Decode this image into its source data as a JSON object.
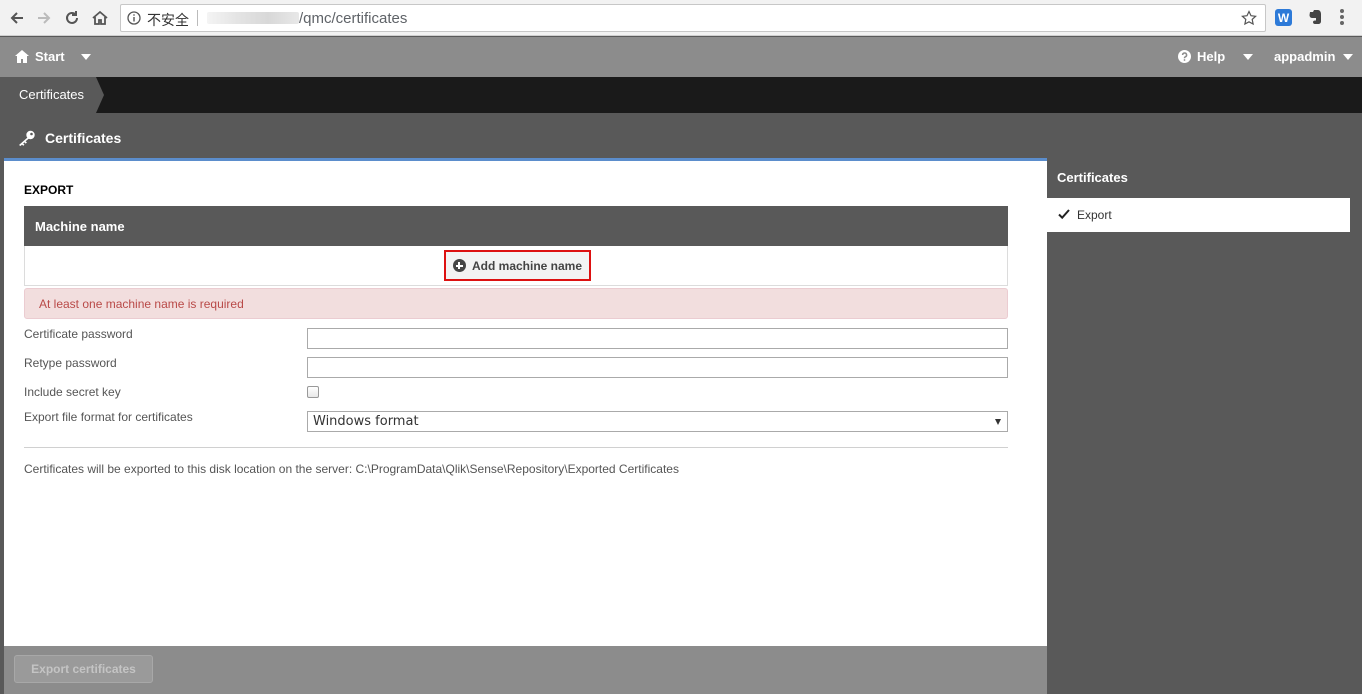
{
  "browser": {
    "insecure_label": "不安全",
    "url_path": "/qmc/certificates",
    "extension_w": "W"
  },
  "header": {
    "start_label": "Start",
    "help_label": "Help",
    "user_label": "appadmin"
  },
  "breadcrumb": {
    "current": "Certificates"
  },
  "section": {
    "title": "Certificates"
  },
  "export": {
    "heading": "EXPORT",
    "machine_name_header": "Machine name",
    "add_machine_label": "Add machine name",
    "error_message": "At least one machine name is required",
    "fields": {
      "certificate_password_label": "Certificate password",
      "retype_password_label": "Retype password",
      "include_secret_key_label": "Include secret key",
      "include_secret_key_checked": false,
      "export_format_label": "Export file format for certificates",
      "export_format_value": "Windows format"
    },
    "info_text": "Certificates will be exported to this disk location on the server: C:\\ProgramData\\Qlik\\Sense\\Repository\\Exported Certificates",
    "export_button_label": "Export certificates"
  },
  "right_panel": {
    "title": "Certificates",
    "items": [
      {
        "label": "Export",
        "selected": true
      }
    ]
  },
  "colors": {
    "header_gray": "#8c8c8c",
    "dark_gray": "#595959",
    "accent_blue": "#5b8dcc",
    "error_text": "#b94a48",
    "highlight_red": "#dd1111"
  }
}
